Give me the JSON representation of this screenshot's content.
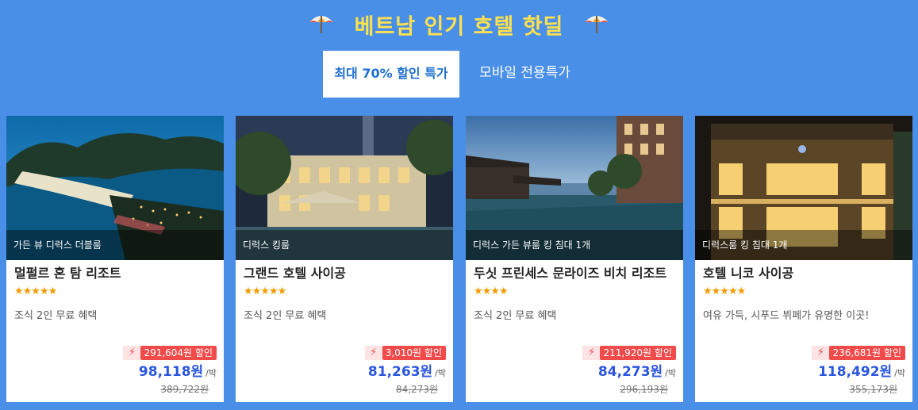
{
  "header": {
    "title": "베트남 인기 호텔 핫딜",
    "icon": "parasol-icon"
  },
  "tabs": [
    {
      "label": "최대 70% 할인 특가",
      "active": true
    },
    {
      "label": "모바일 전용특가",
      "active": false
    }
  ],
  "cards": [
    {
      "room": "가든 뷰 디럭스 더블룸",
      "name": "멀펄르 혼 탐 리조트",
      "stars": "★★★★★",
      "benefit": "조식 2인 무료 혜택",
      "discount": "291,604원 할인",
      "price": "98,118원",
      "per": "/박",
      "original": "389,722원"
    },
    {
      "room": "디럭스 킹룸",
      "name": "그랜드 호텔 사이공",
      "stars": "★★★★★",
      "benefit": "조식 2인 무료 혜택",
      "discount": "3,010원 할인",
      "price": "81,263원",
      "per": "/박",
      "original": "84,273원"
    },
    {
      "room": "디럭스 가든 뷰룸 킹 침대 1개",
      "name": "두싯 프린세스 문라이즈 비치 리조트",
      "stars": "★★★★",
      "benefit": "조식 2인 무료 혜택",
      "discount": "211,920원 할인",
      "price": "84,273원",
      "per": "/박",
      "original": "296,193원"
    },
    {
      "room": "디럭스룸 킹 침대 1개",
      "name": "호텔 니코 사이공",
      "stars": "★★★★★",
      "benefit": "여유 가득, 시푸드 뷔페가 유명한 이곳!",
      "discount": "236,681원 할인",
      "price": "118,492원",
      "per": "/박",
      "original": "355,173원"
    }
  ],
  "colors": {
    "background": "#4a8fe7",
    "title": "#ffe14d",
    "price": "#2a56e0",
    "discount": "#f04a4a",
    "stars": "#f59a00"
  }
}
